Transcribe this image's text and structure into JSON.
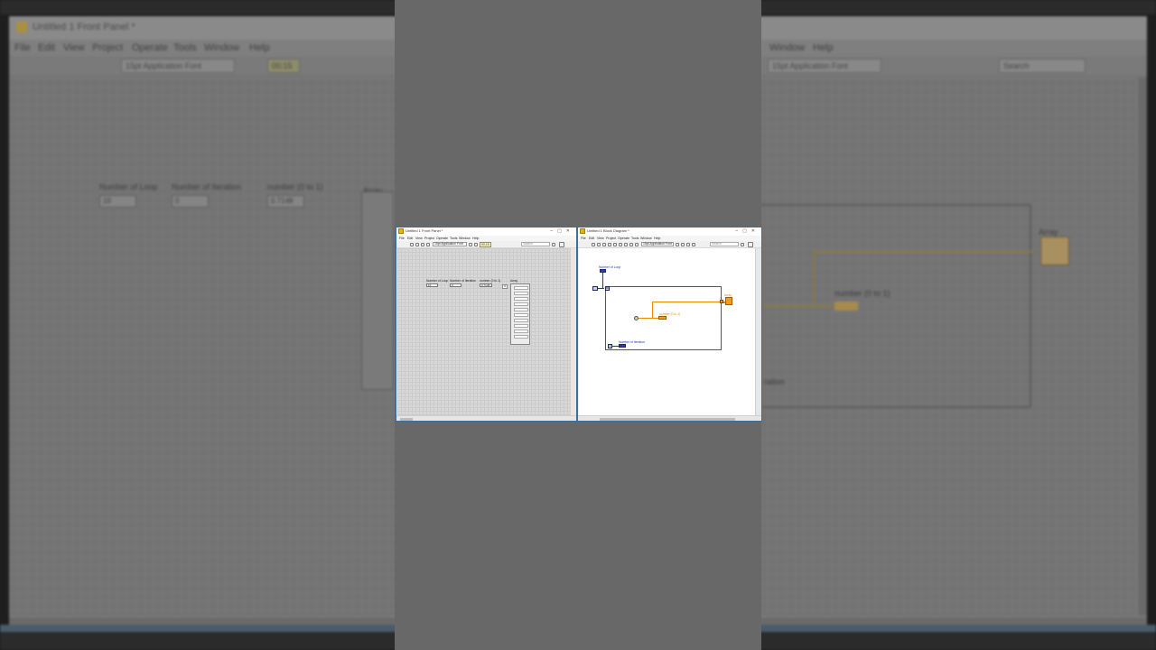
{
  "background": {
    "title": "Untitled 1 Front Panel *",
    "menu": [
      "File",
      "Edit",
      "View",
      "Project",
      "Operate",
      "Tools",
      "Window",
      "Help"
    ],
    "font": "15pt Application Font",
    "right_menu": [
      "Window",
      "Help"
    ],
    "right_font": "15pt Application Font",
    "search": "Search",
    "zoom": "00:15",
    "controls": [
      {
        "label": "Number of Loop",
        "value": "10"
      },
      {
        "label": "Number of Iteration",
        "value": "0"
      },
      {
        "label": "number (0 to 1)",
        "value": "0.7148"
      }
    ],
    "array_label": "Array",
    "diagram_labels": {
      "number": "number (0 to 1)",
      "iteration": "ration"
    }
  },
  "front_panel": {
    "title": "Untitled 1 Front Panel *",
    "menu": [
      "File",
      "Edit",
      "View",
      "Project",
      "Operate",
      "Tools",
      "Window",
      "Help"
    ],
    "font": "15pt Application Font",
    "zoom": "00:15",
    "search": "Search",
    "controls": [
      {
        "label": "Number of Loop",
        "value": "10"
      },
      {
        "label": "Number of Iteration",
        "value": "0"
      },
      {
        "label": "number (0 to 1)",
        "value": "0.7148"
      }
    ],
    "array_label": "Array",
    "array_index": "0"
  },
  "block_diagram": {
    "title": "Untitled 1 Block Diagram *",
    "menu": [
      "File",
      "Edit",
      "View",
      "Project",
      "Operate",
      "Tools",
      "Window",
      "Help"
    ],
    "font": "15pt Application Font",
    "search": "Search",
    "labels": {
      "loop_count": "Number of Loop",
      "random": "number (0 to 1)",
      "array": "Array",
      "iteration": "Number of Iteration"
    },
    "n_terminal": "N",
    "i_terminal": "i"
  },
  "colors": {
    "int_wire": "#1c37b5",
    "dbl_wire": "#ef8a00",
    "accent": "#3b6fa0"
  }
}
